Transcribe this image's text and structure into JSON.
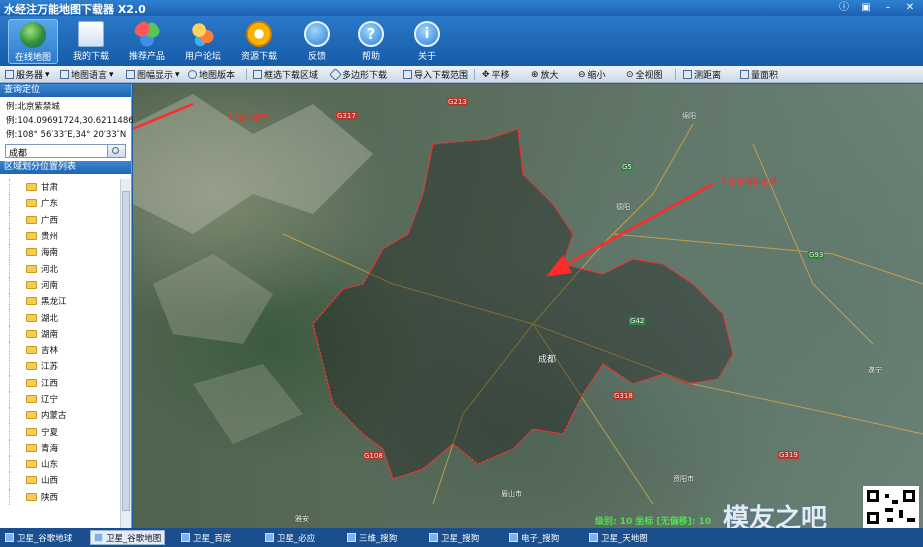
{
  "window": {
    "title": "水经注万能地图下载器 X2.0"
  },
  "toolbar": {
    "buttons": [
      {
        "label": "在线地图",
        "icon": "globe-icon",
        "active": true
      },
      {
        "label": "我的下载",
        "icon": "downloads-icon"
      },
      {
        "label": "推荐产品",
        "icon": "products-icon"
      },
      {
        "label": "用户论坛",
        "icon": "forum-icon"
      },
      {
        "label": "资源下载",
        "icon": "resource-icon"
      },
      {
        "label": "反馈",
        "icon": "feedback-icon"
      },
      {
        "label": "帮助",
        "icon": "help-icon"
      },
      {
        "label": "关于",
        "icon": "about-icon"
      }
    ]
  },
  "subtoolbar": {
    "items": [
      "服务器",
      "地图语言",
      "图幅显示",
      "地图版本",
      "框选下载区域",
      "多边形下载",
      "导入下载范围",
      "平移",
      "放大",
      "缩小",
      "全视图",
      "测距离",
      "量面积"
    ]
  },
  "left_panel": {
    "query_header": "查询定位",
    "example1": "例:北京紫禁城",
    "example2": "例:104.09691724,30.62114865",
    "example3": "例:108° 56′33″E,34° 20′33″N",
    "search_value": "成都",
    "region_header": "区域划分位置列表",
    "provinces": [
      "甘肃",
      "广东",
      "广西",
      "贵州",
      "海南",
      "河北",
      "河南",
      "黑龙江",
      "湖北",
      "湖南",
      "吉林",
      "江苏",
      "江西",
      "辽宁",
      "内蒙古",
      "宁夏",
      "青海",
      "山东",
      "山西",
      "陕西"
    ]
  },
  "map": {
    "annotation1": "1.输入城市",
    "annotation2": "2.显示成都区域",
    "labels": [
      {
        "text": "绵阳"
      },
      {
        "text": "德阳"
      },
      {
        "text": "成都"
      },
      {
        "text": "资阳市"
      },
      {
        "text": "眉山市"
      },
      {
        "text": "雅安"
      },
      {
        "text": "遂宁"
      },
      {
        "text": "G317"
      },
      {
        "text": "G213"
      },
      {
        "text": "G5"
      },
      {
        "text": "G42"
      },
      {
        "text": "G318"
      },
      {
        "text": "G93"
      },
      {
        "text": "G108"
      },
      {
        "text": "G319"
      }
    ],
    "status": "级别: 10  坐标 [无偏移]: 10"
  },
  "watermark": "模友之吧",
  "bottom_tabs": [
    {
      "label": "卫星_谷歌地球",
      "active": false
    },
    {
      "label": "卫星_谷歌地图",
      "active": true
    },
    {
      "label": "卫星_百度"
    },
    {
      "label": "卫星_必应"
    },
    {
      "label": "三维_搜狗"
    },
    {
      "label": "卫星_搜狗"
    },
    {
      "label": "电子_搜狗"
    },
    {
      "label": "卫星_天地图"
    }
  ],
  "colors": {
    "boundary": "#ff3030",
    "toolbar": "#1b62b3"
  }
}
